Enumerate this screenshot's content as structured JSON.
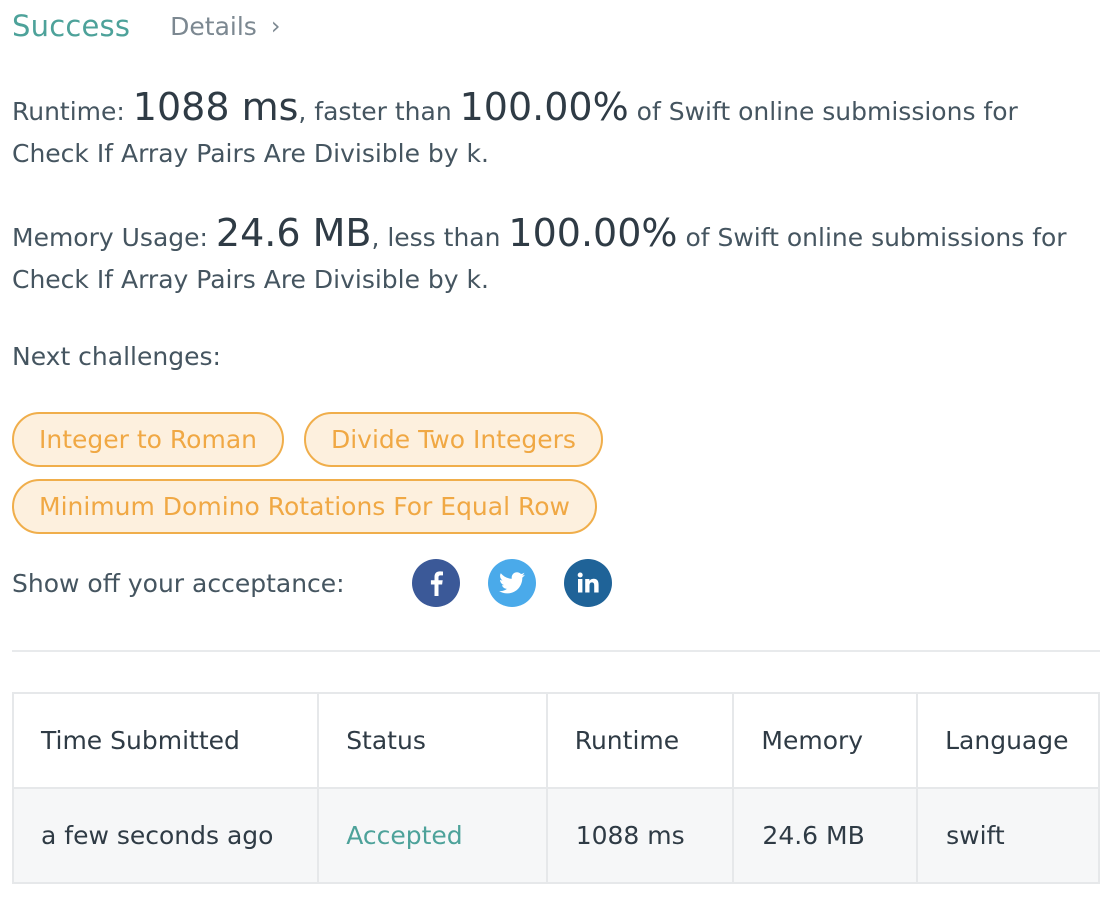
{
  "header": {
    "status": "Success",
    "details_label": "Details",
    "details_chevron": "›"
  },
  "runtime": {
    "label": "Runtime: ",
    "value": "1088 ms",
    "mid_text": ", faster than ",
    "percent": "100.00%",
    "suffix": " of Swift online submissions for Check If Array Pairs Are Divisible by k."
  },
  "memory": {
    "label": "Memory Usage: ",
    "value": "24.6 MB",
    "mid_text": ", less than ",
    "percent": "100.00%",
    "suffix": " of Swift online submissions for Check If Array Pairs Are Divisible by k."
  },
  "next_challenges": {
    "label": "Next challenges:",
    "items": [
      "Integer to Roman",
      "Divide Two Integers",
      "Minimum Domino Rotations For Equal Row"
    ]
  },
  "share": {
    "label": "Show off your acceptance:",
    "icons": [
      "facebook-icon",
      "twitter-icon",
      "linkedin-icon"
    ],
    "colors": {
      "facebook": "#3b5998",
      "twitter": "#4aaaea",
      "linkedin": "#1f6398"
    }
  },
  "table": {
    "headers": [
      "Time Submitted",
      "Status",
      "Runtime",
      "Memory",
      "Language"
    ],
    "rows": [
      {
        "time": "a few seconds ago",
        "status": "Accepted",
        "runtime": "1088 ms",
        "memory": "24.6 MB",
        "language": "swift"
      }
    ]
  },
  "colors": {
    "success": "#4da29a",
    "pill_border": "#f0ae4b",
    "pill_bg": "#fdf0de",
    "pill_text": "#f0a844"
  }
}
